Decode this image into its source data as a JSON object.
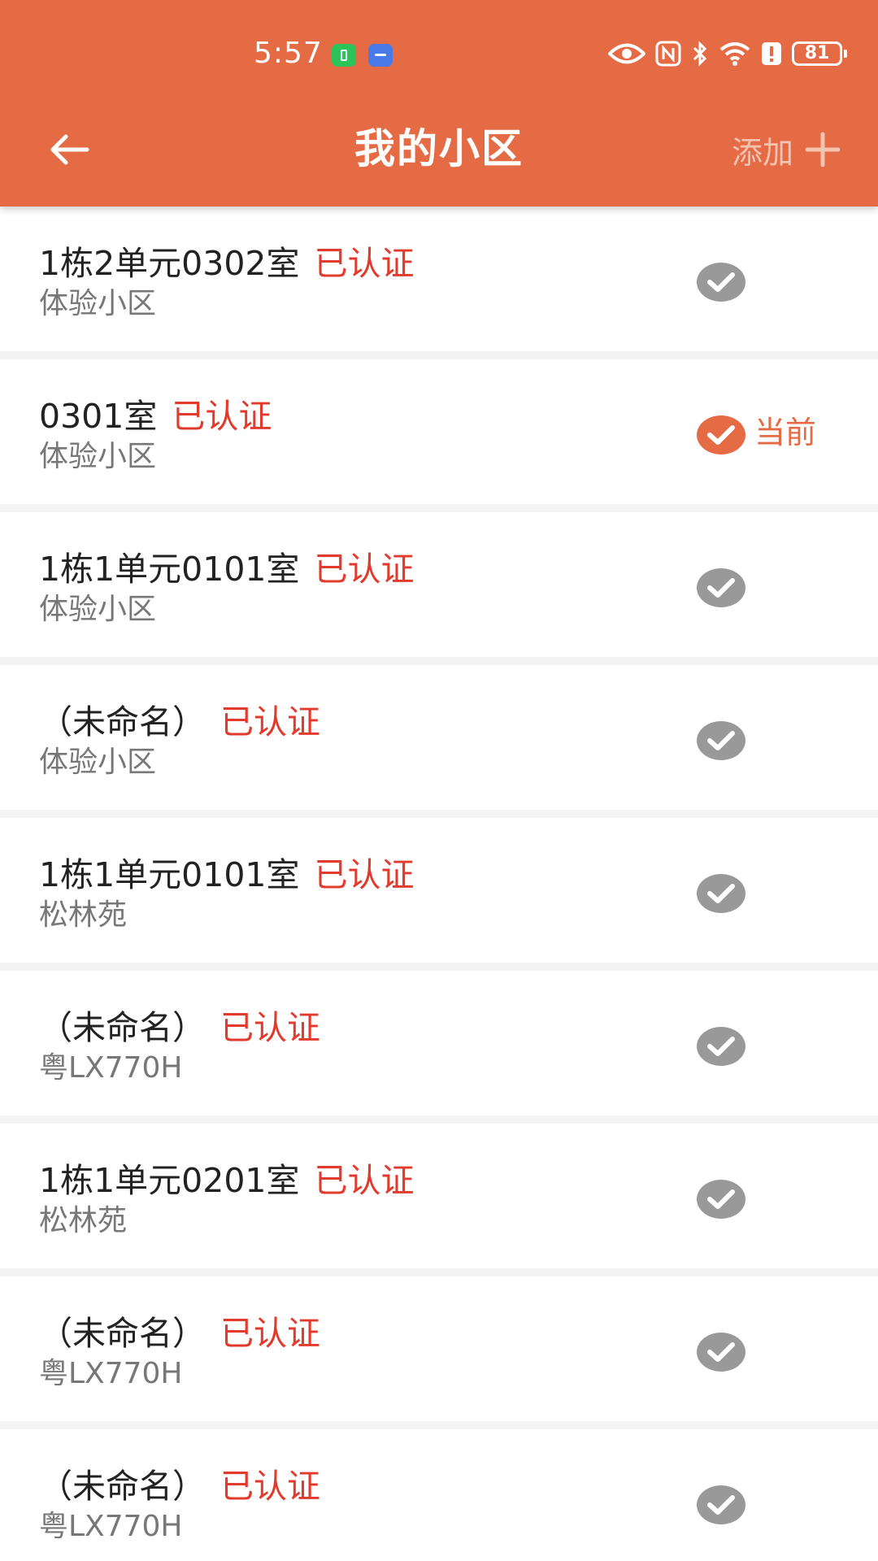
{
  "status_bar": {
    "time": "5:57",
    "battery": "81",
    "icons": [
      "battery-saver-icon",
      "usb-icon",
      "eye-icon",
      "nfc-icon",
      "bluetooth-icon",
      "wifi-icon",
      "alert-icon",
      "battery-icon"
    ]
  },
  "header": {
    "title": "我的小区",
    "add_label": "添加",
    "back_icon": "arrow-left-icon",
    "add_icon": "plus-icon"
  },
  "colors": {
    "header_bg": "#e56b45",
    "status_red": "#e23b2e",
    "check_gray": "#999999",
    "check_current": "#e56b45"
  },
  "list": {
    "items": [
      {
        "title": "1栋2单元0302室",
        "status": "已认证",
        "subtitle": "体验小区",
        "current": false
      },
      {
        "title": "0301室",
        "status": "已认证",
        "subtitle": "体验小区",
        "current": true,
        "current_label": "当前"
      },
      {
        "title": "1栋1单元0101室",
        "status": "已认证",
        "subtitle": "体验小区",
        "current": false
      },
      {
        "title": "（未命名）",
        "status": "已认证",
        "subtitle": "体验小区",
        "current": false
      },
      {
        "title": "1栋1单元0101室",
        "status": "已认证",
        "subtitle": "松林苑",
        "current": false
      },
      {
        "title": "（未命名）",
        "status": "已认证",
        "subtitle": "粤LX770H",
        "current": false
      },
      {
        "title": "1栋1单元0201室",
        "status": "已认证",
        "subtitle": "松林苑",
        "current": false
      },
      {
        "title": "（未命名）",
        "status": "已认证",
        "subtitle": "粤LX770H",
        "current": false
      },
      {
        "title": "（未命名）",
        "status": "已认证",
        "subtitle": "粤LX770H",
        "current": false
      }
    ]
  }
}
